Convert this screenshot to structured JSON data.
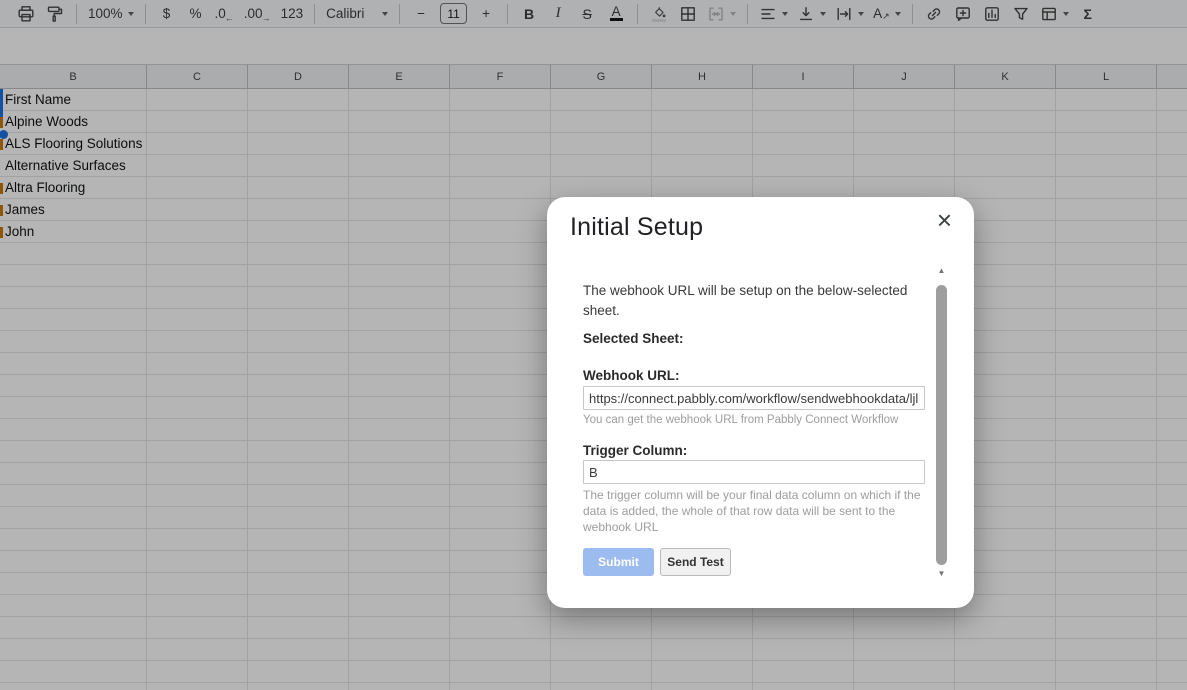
{
  "toolbar": {
    "zoom": "100%",
    "currency": "$",
    "percent": "%",
    "decrease_decimal": ".0",
    "decrease_decimal_arrow": "←",
    "increase_decimal": ".00",
    "increase_decimal_arrow": "→",
    "more_formats": "123",
    "font_name": "Calibri",
    "decrease_font_size": "−",
    "font_size": "11",
    "increase_font_size": "+",
    "bold": "B",
    "italic": "I",
    "strikethrough": "S",
    "text_color": "A",
    "text_rotation": "A",
    "text_rotation_arrow": "↗",
    "functions": "Σ"
  },
  "icons": {
    "close": "×",
    "scroll_up": "▲",
    "scroll_down": "▼"
  },
  "sheet": {
    "columns": [
      "B",
      "C",
      "D",
      "E",
      "F",
      "G",
      "H",
      "I",
      "J",
      "K",
      "L"
    ],
    "rows": [
      "First Name",
      "Alpine Woods",
      "ALS Flooring Solutions",
      "Alternative Surfaces",
      "Altra Flooring",
      "James",
      "John"
    ]
  },
  "modal": {
    "title": "Initial Setup",
    "intro": "The webhook URL will be setup on the below-selected sheet.",
    "selected_sheet_label": "Selected Sheet:",
    "webhook_url_label": "Webhook URL:",
    "webhook_url_value": "https://connect.pabbly.com/workflow/sendwebhookdata/ljl",
    "webhook_url_help": "You can get the webhook URL from Pabbly Connect Workflow",
    "trigger_column_label": "Trigger Column:",
    "trigger_column_value": "B",
    "trigger_column_help": "The trigger column will be your final data column on which if the data is added, the whole of that row data will be sent to the webhook URL",
    "submit_label": "Submit",
    "send_test_label": "Send Test"
  },
  "colors": {
    "accent_blue": "#1a73e8",
    "submit_disabled_bg": "#9cbbee",
    "overflow_marker_orange": "#c97908",
    "scrollbar_thumb": "#9e9e9e"
  }
}
